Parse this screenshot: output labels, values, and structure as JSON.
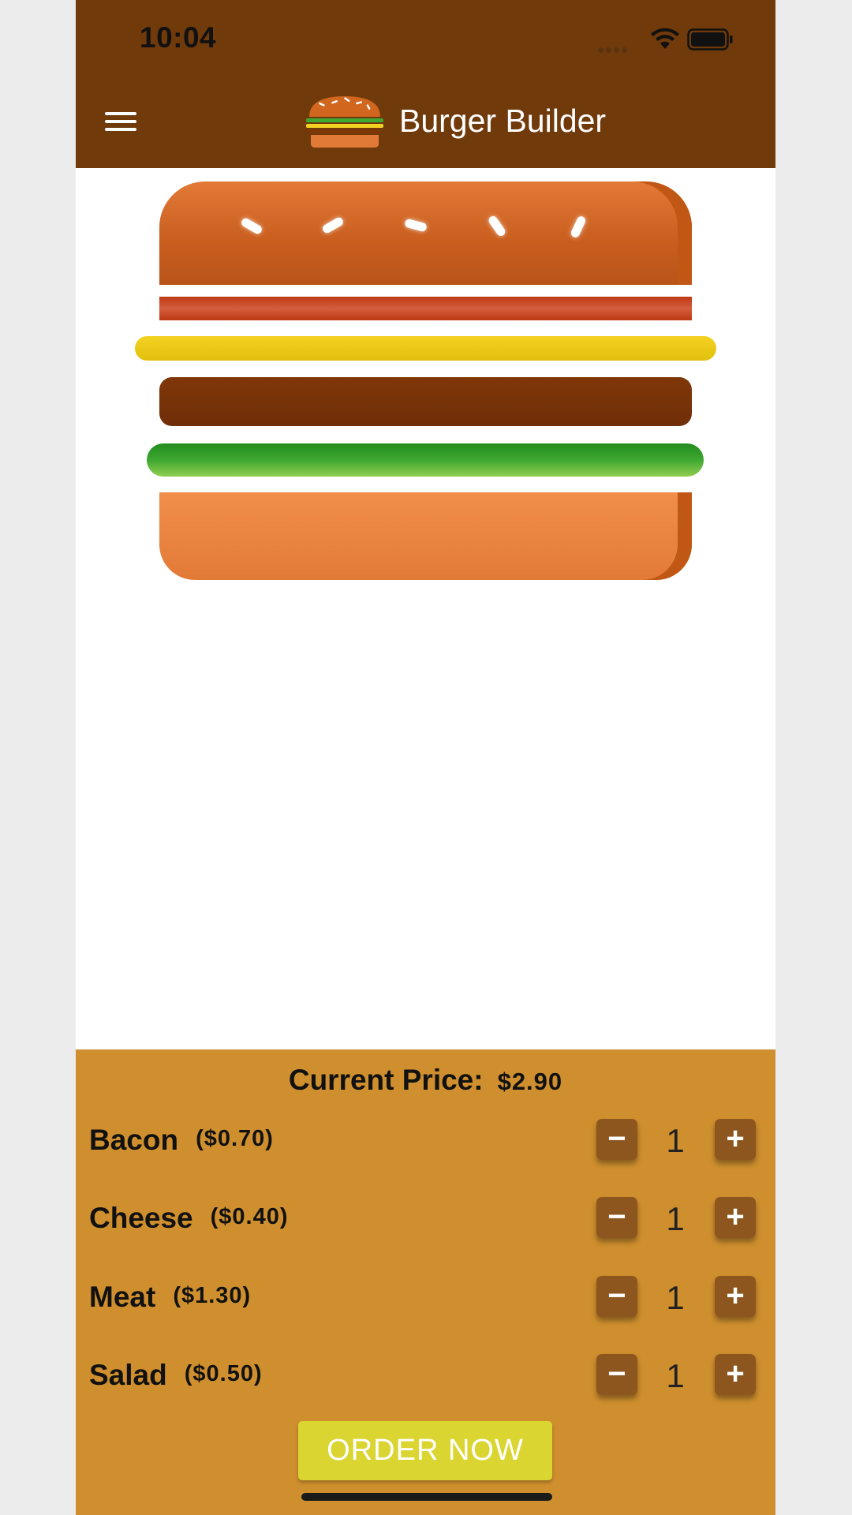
{
  "status_bar": {
    "time": "10:04"
  },
  "app_bar": {
    "title": "Burger Builder",
    "menu_icon": "hamburger-menu-icon",
    "logo_icon": "burger-logo-icon"
  },
  "burger": {
    "layers": [
      "bread-top",
      "bacon",
      "cheese",
      "meat",
      "salad",
      "bread-bottom"
    ],
    "colors": {
      "bread": "#e27a37",
      "bacon": "#bf3813",
      "cheese": "#f4d222",
      "meat": "#702e08",
      "salad": "#3fa832"
    }
  },
  "controls": {
    "price_label": "Current Price:",
    "price_value": "$2.90",
    "less_symbol": "−",
    "more_symbol": "+",
    "items": [
      {
        "label": "Bacon",
        "price": "($0.70)",
        "quantity": "1"
      },
      {
        "label": "Cheese",
        "price": "($0.40)",
        "quantity": "1"
      },
      {
        "label": "Meat",
        "price": "($1.30)",
        "quantity": "1"
      },
      {
        "label": "Salad",
        "price": "($0.50)",
        "quantity": "1"
      }
    ],
    "order_button": "ORDER NOW"
  },
  "theme": {
    "toolbar": "#703a0b",
    "controls_background": "#cf8f2e",
    "control_button": "#8c561e",
    "order_button": "#dad531"
  }
}
